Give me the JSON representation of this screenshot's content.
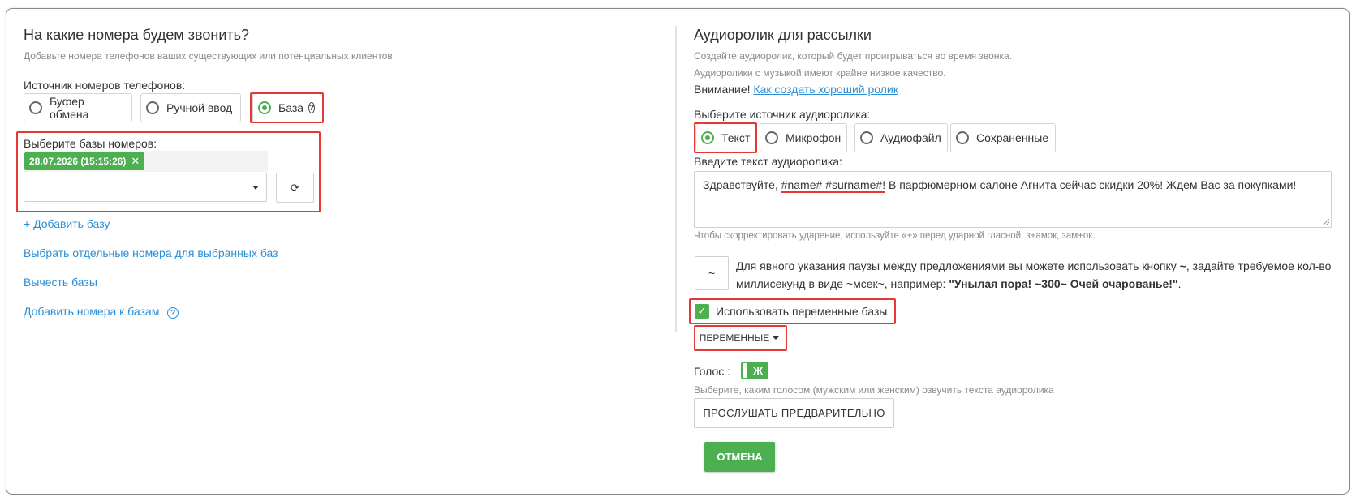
{
  "left": {
    "title": "На какие номера будем звонить?",
    "subtitle": "Добавьте номера телефонов ваших существующих или потенциальных клиентов.",
    "source_label": "Источник номеров телефонов:",
    "sources": [
      {
        "label": "Буфер обмена",
        "checked": false
      },
      {
        "label": "Ручной ввод",
        "checked": false
      },
      {
        "label": "База",
        "checked": true
      }
    ],
    "bases_label": "Выберите базы номеров:",
    "selected_base_tag": "28.07.2026 (15:15:26)",
    "tag_remove": "✕",
    "refresh_glyph": "⟳",
    "add_base": "+ Добавить базу",
    "select_numbers": "Выбрать отдельные номера для выбранных баз",
    "subtract_bases": "Вычесть базы",
    "add_numbers": "Добавить номера к базам",
    "help_glyph": "?"
  },
  "right": {
    "title": "Аудиоролик для рассылки",
    "subtitle1": "Создайте аудиоролик, который будет проигрываться во время звонка.",
    "subtitle2": "Аудиоролики с музыкой имеют крайне низкое качество.",
    "warning_prefix": "Внимание!",
    "warning_link": "Как создать хороший ролик",
    "source_label": "Выберите источник аудиоролика:",
    "sources": [
      {
        "label": "Текст",
        "checked": true
      },
      {
        "label": "Микрофон",
        "checked": false
      },
      {
        "label": "Аудиофайл",
        "checked": false
      },
      {
        "label": "Сохраненные",
        "checked": false
      }
    ],
    "text_label": "Введите текст аудиоролика:",
    "text_part1": "Здравствуйте, ",
    "text_vars": "#name# #surname#!",
    "text_part2": " В парфюмерном салоне Агнита сейчас скидки 20%! Ждем Вас за покупками!",
    "stress_hint": "Чтобы скорректировать ударение, используйте «+» перед ударной гласной: з+амок, зам+ок.",
    "pause_btn": "~",
    "pause_text_1": "Для явного указания паузы между предложениями вы можете использовать кнопку ",
    "pause_tilde": "~",
    "pause_text_2": ", задайте требуемое кол-во миллисекунд в виде ~мсек~, например: ",
    "pause_example": "\"Унылая пора! ~300~ Очей очарованье!\"",
    "pause_text_3": ".",
    "use_vars_check": "✓",
    "use_vars_label": "Использовать переменные базы",
    "vars_button": "ПЕРЕМЕННЫЕ",
    "voice_label": "Голос :",
    "voice_value": "Ж",
    "voice_hint": "Выберите, каким голосом (мужским или женским) озвучить текста аудиоролика",
    "preview_button": "ПРОСЛУШАТЬ ПРЕДВАРИТЕЛЬНО",
    "cancel_button": "ОТМЕНА"
  },
  "colors": {
    "accent_green": "#4caf50",
    "link_blue": "#2b8fd6",
    "highlight_red": "#e53935"
  }
}
